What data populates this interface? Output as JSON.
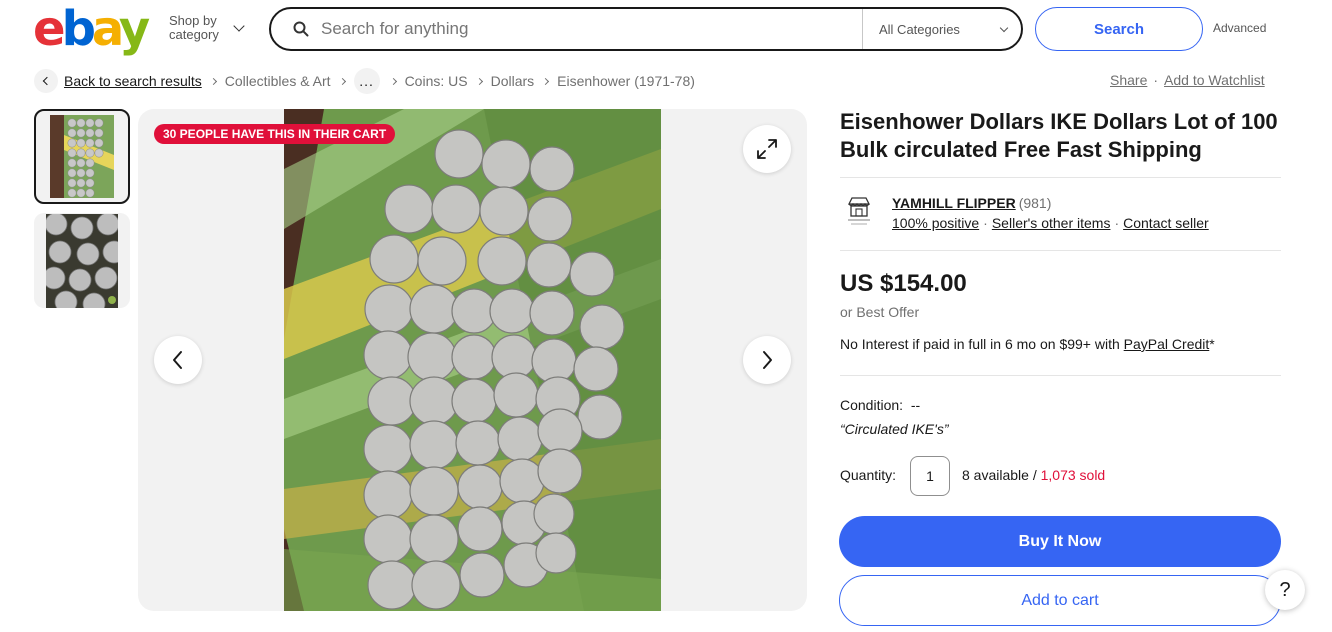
{
  "header": {
    "logo_letters": [
      "e",
      "b",
      "a",
      "y"
    ],
    "shop_by_category": "Shop by category",
    "search_placeholder": "Search for anything",
    "category_select": "All Categories",
    "search_button": "Search",
    "advanced_link": "Advanced"
  },
  "breadcrumb": {
    "back": "Back to search results",
    "items": [
      "Collectibles & Art",
      "Coins: US",
      "Dollars",
      "Eisenhower (1971-78)"
    ],
    "ellipsis": "...",
    "share": "Share",
    "separator": "·",
    "watchlist": "Add to Watchlist"
  },
  "gallery": {
    "cart_badge": "30 PEOPLE HAVE THIS IN THEIR CART",
    "thumbnail_count": 2,
    "selected_thumbnail": 1
  },
  "listing": {
    "title": "Eisenhower Dollars IKE Dollars Lot of 100 Bulk circulated Free Fast Shipping",
    "seller_name": "YAMHILL FLIPPER",
    "seller_feedback": "(981)",
    "seller_positive": "100% positive",
    "seller_other_items": "Seller's other items",
    "contact_seller": "Contact seller",
    "price": "US $154.00",
    "best_offer": "or Best Offer",
    "credit_text": "No Interest if paid in full in 6 mo on $99+ with",
    "credit_link": "PayPal Credit",
    "credit_suffix": "*",
    "condition_label": "Condition:",
    "condition_value": "--",
    "condition_note": "“Circulated IKE's”",
    "quantity_label": "Quantity:",
    "quantity_value": "1",
    "available": "8 available / ",
    "sold": "1,073 sold",
    "buy_now": "Buy It Now",
    "add_to_cart": "Add to cart",
    "help": "?"
  },
  "colors": {
    "accent": "#3665f3",
    "badge": "#e0103a",
    "text": "#191919",
    "muted": "#707070"
  }
}
